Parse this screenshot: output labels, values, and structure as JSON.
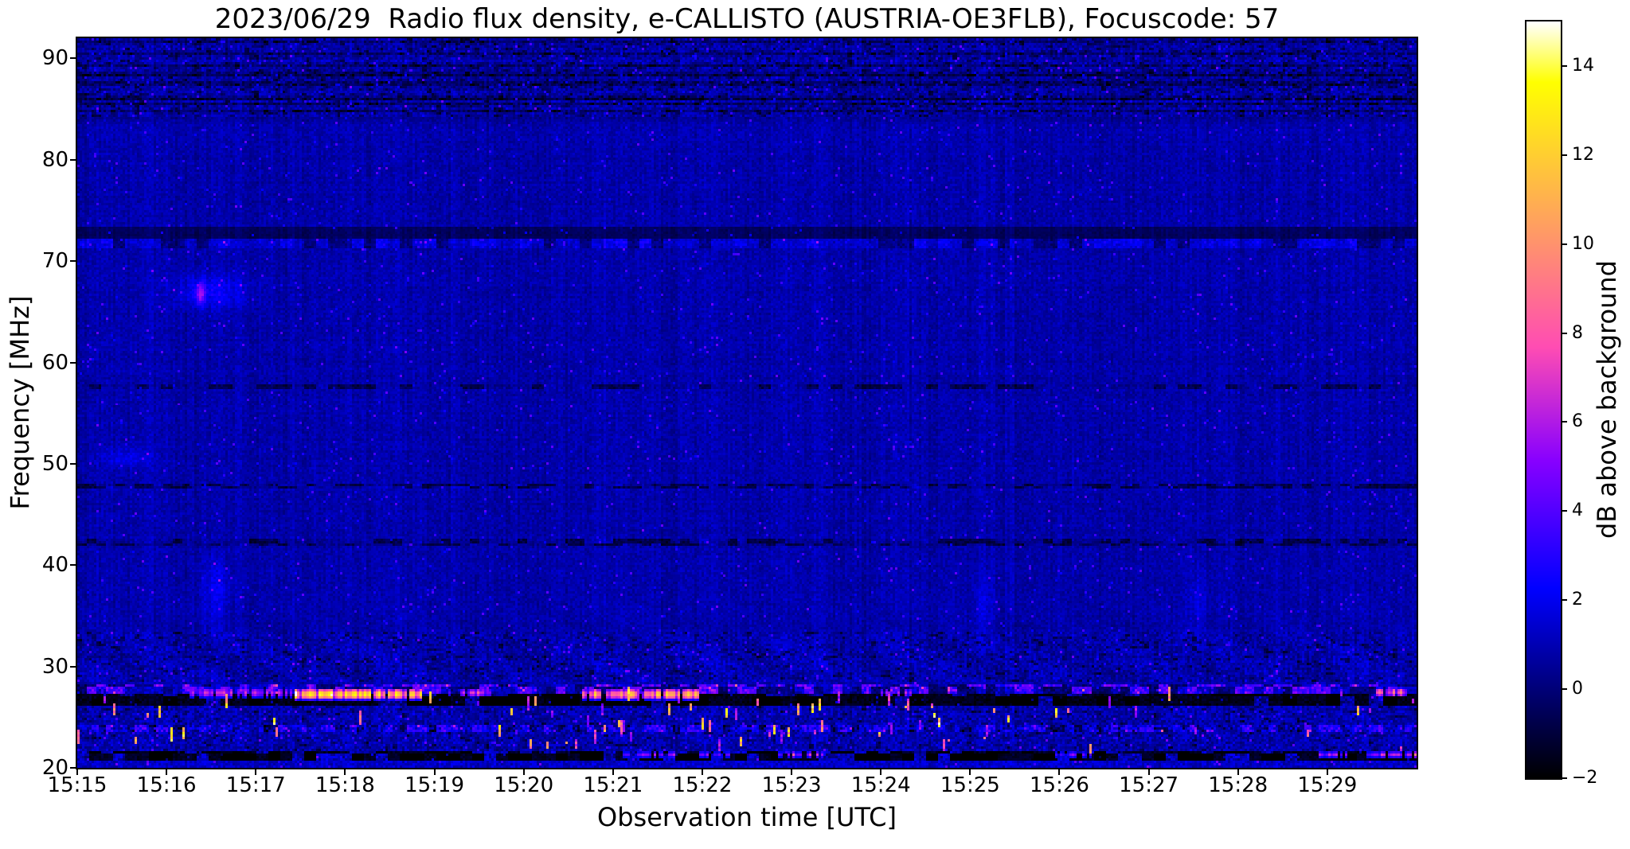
{
  "figure": {
    "background": "#ffffff",
    "text_color": "#000000"
  },
  "chart_data": {
    "type": "heatmap",
    "subtype": "radio-spectrogram",
    "title": "2023/06/29  Radio flux density, e-CALLISTO (AUSTRIA-OE3FLB), Focuscode: 57",
    "xlabel": "Observation time [UTC]",
    "ylabel": "Frequency [MHz]",
    "x_ticks": [
      "15:15",
      "15:16",
      "15:17",
      "15:18",
      "15:19",
      "15:20",
      "15:21",
      "15:22",
      "15:23",
      "15:24",
      "15:25",
      "15:26",
      "15:27",
      "15:28",
      "15:29"
    ],
    "x_tick_minutes": [
      0,
      1,
      2,
      3,
      4,
      5,
      6,
      7,
      8,
      9,
      10,
      11,
      12,
      13,
      14
    ],
    "xlim_minutes": [
      0,
      15
    ],
    "x_start_time": "15:15",
    "x_end_time": "15:30",
    "y_ticks": [
      90,
      80,
      70,
      60,
      50,
      40,
      30,
      20
    ],
    "ylim": [
      20,
      92
    ],
    "grid": false,
    "colorbar": {
      "label": "dB above background",
      "ticks": [
        14,
        12,
        10,
        8,
        6,
        4,
        2,
        0,
        -2
      ],
      "tick_labels": [
        "14",
        "12",
        "10",
        "8",
        "6",
        "4",
        "2",
        "0",
        "−2"
      ],
      "vmin": -2,
      "vmax": 15,
      "colormap": "gnuplot2",
      "colormap_stops": {
        "0.00": "#000000",
        "0.25": "#0000ff",
        "0.45": "#9106f2",
        "0.60": "#ff53ac",
        "0.75": "#ffa857",
        "0.92": "#ffff00",
        "1.00": "#ffffff"
      }
    },
    "spectrogram": {
      "bg": {
        "base": 0.85,
        "colnoise": 0.5,
        "colnoise2": 0.3,
        "rownoise": 0.2,
        "pxnoise": 0.95,
        "speckle_p": 0.015,
        "speckle_amp": 2.2
      },
      "wave": {
        "f0": 28.5,
        "f1": 38.0,
        "amp": 0.33,
        "period_min": 1.2
      },
      "bands": [
        {
          "name": "top-noise",
          "f0": 84.3,
          "f1": 92.1,
          "dv": -0.1,
          "noise": 1.6,
          "speck": 2.2,
          "rowmod": true,
          "microdash": 0.16
        },
        {
          "name": "dark-stripe-88",
          "f0": 88.2,
          "f1": 88.8,
          "dv": -0.5
        },
        {
          "name": "dark-stripe-86",
          "f0": 85.8,
          "f1": 86.4,
          "dv": -0.45
        },
        {
          "name": "dark-stripe-84",
          "f0": 83.7,
          "f1": 84.3,
          "dv": -0.3
        },
        {
          "name": "dark-band-73",
          "f0": 72.3,
          "f1": 73.3,
          "dv": -1.3,
          "noise": 0.5
        },
        {
          "name": "bright-band-72",
          "f0": 71.4,
          "f1": 72.3,
          "dv": 0.55,
          "noise": 1.2,
          "dash": {
            "len": 5,
            "darkP": 0.22,
            "brightP": 0.25,
            "amp": 0.8
          }
        },
        {
          "name": "dash-row-58",
          "f0": 57.5,
          "f1": 58.0,
          "dv": -0.25,
          "dash": {
            "len": 5,
            "darkP": 0.35,
            "brightP": 0.1,
            "amp": 0.5
          }
        },
        {
          "name": "dash-row-48",
          "f0": 47.5,
          "f1": 48.1,
          "dv": -0.35,
          "dash": {
            "len": 4,
            "darkP": 0.45,
            "brightP": 0.12,
            "amp": 0.8
          }
        },
        {
          "name": "dash-row-42",
          "f0": 42.0,
          "f1": 42.6,
          "dv": -0.3,
          "dash": {
            "len": 4,
            "darkP": 0.4,
            "brightP": 0.1,
            "amp": 0.6
          }
        },
        {
          "name": "speckle-29-33",
          "f0": 28.4,
          "f1": 33.5,
          "dv": 0.05,
          "noise": 1.6,
          "speck": 1.8,
          "microdash": 0.1
        },
        {
          "name": "bright-dash-row-28",
          "f0": 27.4,
          "f1": 28.15,
          "dv": 0.35,
          "noise": 1.4,
          "speck": 2.0,
          "dash": {
            "len": 4,
            "darkP": 0.3,
            "brightP": 0.38,
            "amp": 3.4
          }
        },
        {
          "name": "black-band-27",
          "f0": 26.2,
          "f1": 27.4,
          "set": -1.55,
          "noise": 0.9,
          "speck": 1.2,
          "dash": {
            "len": 6,
            "darkP": 0.3,
            "brightP": 0.22,
            "amp": 2.6
          }
        },
        {
          "name": "active-22-26",
          "f0": 21.7,
          "f1": 26.2,
          "noise": 1.8,
          "speck": 2.2,
          "microdash": 0.08
        },
        {
          "name": "purple-dash-row-24",
          "f0": 23.5,
          "f1": 24.2,
          "dv": 0.5,
          "noise": 1.5,
          "dash": {
            "len": 3,
            "darkP": 0.25,
            "brightP": 0.33,
            "amp": 1.8
          }
        },
        {
          "name": "dark-band-21",
          "f0": 20.6,
          "f1": 21.7,
          "set": -1.35,
          "noise": 0.8,
          "dash": {
            "len": 5,
            "darkP": 0.4,
            "brightP": 0.3,
            "amp": 3.0
          }
        },
        {
          "name": "bottom-blue-row",
          "f0": 20.0,
          "f1": 20.6,
          "set": 1.3,
          "noise": 1.6,
          "speck": 1.5
        }
      ],
      "bursts": [
        {
          "t0": 1.25,
          "t1": 2.4,
          "f0": 26.9,
          "f1": 27.9,
          "peak": 6.5,
          "gap": 0.45
        },
        {
          "t0": 2.45,
          "t1": 3.85,
          "f0": 26.7,
          "f1": 27.8,
          "peak": 12.5,
          "gap": 0.12
        },
        {
          "t0": 4.15,
          "t1": 4.65,
          "f0": 27.0,
          "f1": 27.8,
          "peak": 7.0,
          "gap": 0.4
        },
        {
          "t0": 5.65,
          "t1": 7.0,
          "f0": 26.7,
          "f1": 27.8,
          "peak": 11.5,
          "gap": 0.15
        },
        {
          "t0": 9.0,
          "t1": 9.35,
          "f0": 27.0,
          "f1": 27.8,
          "peak": 6.0,
          "gap": 0.5
        },
        {
          "t0": 14.55,
          "t1": 14.9,
          "f0": 27.0,
          "f1": 27.9,
          "peak": 9.0,
          "gap": 0.25
        },
        {
          "t0": 6.1,
          "t1": 6.7,
          "f0": 21.0,
          "f1": 21.6,
          "peak": 6.0,
          "gap": 0.3
        },
        {
          "t0": 6.95,
          "t1": 7.3,
          "f0": 21.0,
          "f1": 21.6,
          "peak": 5.5,
          "gap": 0.3
        },
        {
          "t0": 7.85,
          "t1": 8.35,
          "f0": 21.0,
          "f1": 21.6,
          "peak": 6.5,
          "gap": 0.3
        },
        {
          "t0": 10.85,
          "t1": 11.35,
          "f0": 21.0,
          "f1": 21.6,
          "peak": 5.0,
          "gap": 0.35
        },
        {
          "t0": 13.9,
          "t1": 14.25,
          "f0": 21.0,
          "f1": 21.6,
          "peak": 6.0,
          "gap": 0.3
        },
        {
          "t0": 14.45,
          "t1": 15.0,
          "f0": 21.0,
          "f1": 21.6,
          "peak": 7.0,
          "gap": 0.25
        }
      ],
      "spots": [
        {
          "tc": 1.5,
          "tw": 0.4,
          "fc": 67.0,
          "fw": 1.6,
          "peak": 1.5
        },
        {
          "tc": 1.38,
          "tw": 0.05,
          "fc": 66.8,
          "fw": 1.0,
          "peak": 4.0
        },
        {
          "tc": 0.55,
          "tw": 0.3,
          "fc": 50.6,
          "fw": 0.9,
          "peak": 1.1
        },
        {
          "tc": 1.55,
          "tw": 0.14,
          "fc": 37.5,
          "fw": 3.2,
          "peak": 1.25
        },
        {
          "tc": 10.15,
          "tw": 0.1,
          "fc": 36.0,
          "fw": 2.8,
          "peak": 0.85
        },
        {
          "tc": 12.55,
          "tw": 0.1,
          "fc": 36.5,
          "fw": 2.8,
          "peak": 0.8
        }
      ],
      "vticks": {
        "f0": 21.8,
        "f1": 27.3,
        "density": 0.1,
        "density_hi": 0.22,
        "hi_t0": 4.3,
        "hi_t1": 9.6,
        "vmin": 4.5,
        "vmax": 12.5
      }
    }
  }
}
